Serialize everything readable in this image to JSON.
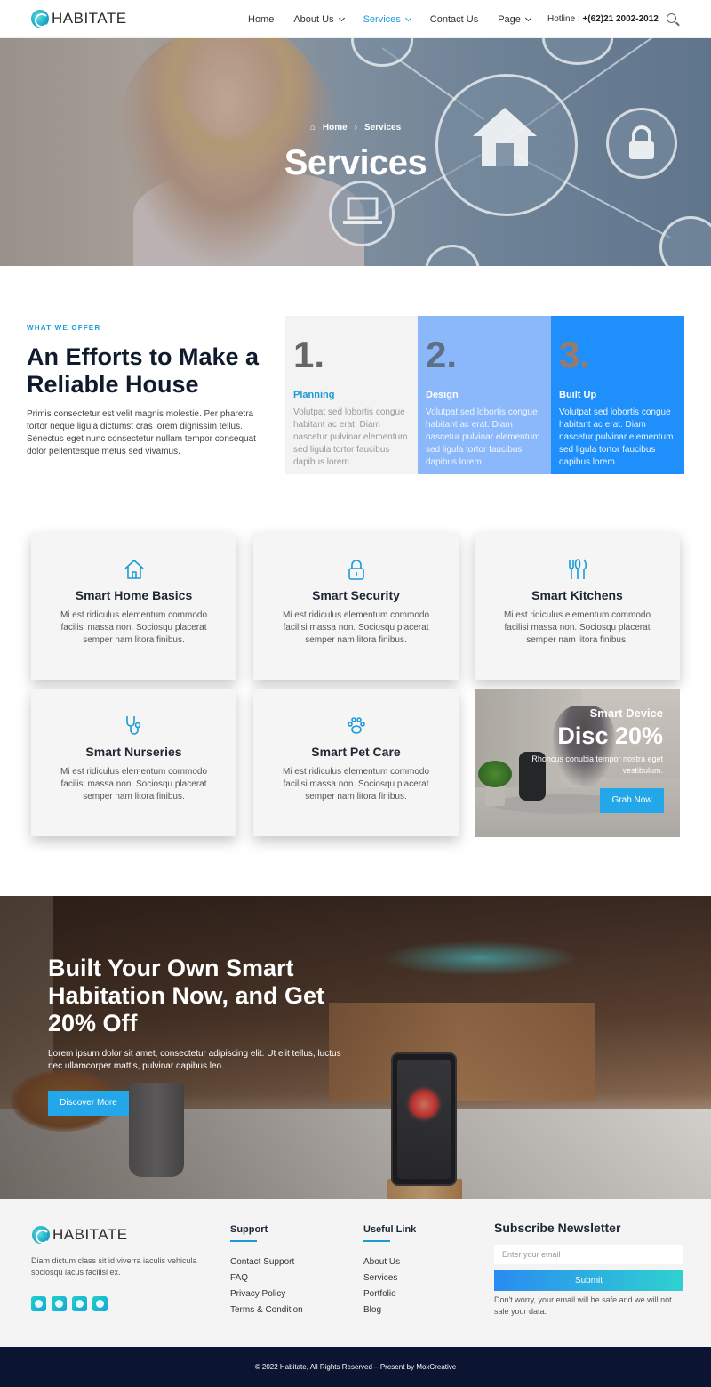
{
  "header": {
    "logo_text": "HABITATE",
    "nav": [
      {
        "label": "Home"
      },
      {
        "label": "About Us"
      },
      {
        "label": "Services"
      },
      {
        "label": "Contact Us"
      },
      {
        "label": "Page"
      }
    ],
    "hotline_label": "Hotline :",
    "hotline_number": "+(62)21 2002-2012",
    "accent_color": "#1a9bd7"
  },
  "hero": {
    "breadcrumb_home": "Home",
    "breadcrumb_current": "Services",
    "title": "Services"
  },
  "offer": {
    "tag": "WHAT WE OFFER",
    "title": "An Efforts to Make a Reliable House",
    "description": "Primis consectetur est velit magnis molestie. Per pharetra tortor neque ligula dictumst cras lorem dignissim tellus. Senectus eget nunc consectetur nullam tempor consequat dolor pellentesque metus sed vivamus.",
    "steps": [
      {
        "number": "1.",
        "title": "Planning",
        "text": "Volutpat sed lobortis congue habitant ac erat. Diam nascetur pulvinar elementum sed ligula tortor faucibus dapibus lorem."
      },
      {
        "number": "2.",
        "title": "Design",
        "text": "Volutpat sed lobortis congue habitant ac erat. Diam nascetur pulvinar elementum sed ligula tortor faucibus dapibus lorem."
      },
      {
        "number": "3.",
        "title": "Built Up",
        "text": "Volutpat sed lobortis congue habitant ac erat. Diam nascetur pulvinar elementum sed ligula tortor faucibus dapibus lorem."
      }
    ]
  },
  "services": [
    {
      "icon": "house-icon",
      "title": "Smart Home Basics",
      "text": "Mi est ridiculus elementum commodo facilisi massa non. Sociosqu placerat semper nam litora finibus."
    },
    {
      "icon": "lock-icon",
      "title": "Smart Security",
      "text": "Mi est ridiculus elementum commodo facilisi massa non. Sociosqu placerat semper nam litora finibus."
    },
    {
      "icon": "cutlery-icon",
      "title": "Smart Kitchens",
      "text": "Mi est ridiculus elementum commodo facilisi massa non. Sociosqu placerat semper nam litora finibus."
    },
    {
      "icon": "stethoscope-icon",
      "title": "Smart Nurseries",
      "text": "Mi est ridiculus elementum commodo facilisi massa non. Sociosqu placerat semper nam litora finibus."
    },
    {
      "icon": "paw-icon",
      "title": "Smart Pet Care",
      "text": "Mi est ridiculus elementum commodo facilisi massa non. Sociosqu placerat semper nam litora finibus."
    }
  ],
  "promo": {
    "subtitle": "Smart Device",
    "title": "Disc 20%",
    "text": "Rhoncus conubia tempor nostra eget vestibulum.",
    "button": "Grab Now"
  },
  "cta": {
    "title": "Built Your Own Smart Habitation Now, and Get 20% Off",
    "text": "Lorem ipsum dolor sit amet, consectetur adipiscing elit. Ut elit tellus, luctus nec ullamcorper mattis, pulvinar dapibus leo.",
    "button": "Discover More"
  },
  "footer": {
    "logo_text": "HABITATE",
    "description": "Diam dictum class sit id viverra iaculis vehicula sociosqu lacus facilisi ex.",
    "socials": [
      "facebook-icon",
      "twitter-icon",
      "youtube-icon",
      "instagram-icon"
    ],
    "support": {
      "title": "Support",
      "links": [
        "Contact Support",
        "FAQ",
        "Privacy Policy",
        "Terms & Condition"
      ]
    },
    "useful": {
      "title": "Useful Link",
      "links": [
        "About Us",
        "Services",
        "Portfolio",
        "Blog"
      ]
    },
    "newsletter": {
      "title": "Subscribe Newsletter",
      "placeholder": "Enter your email",
      "button": "Submit",
      "note": "Don't worry, your email will be safe and we will not sale your data."
    },
    "copyright": "© 2022 Habitate, All Rights Reserved – Present by MoxCreative"
  }
}
